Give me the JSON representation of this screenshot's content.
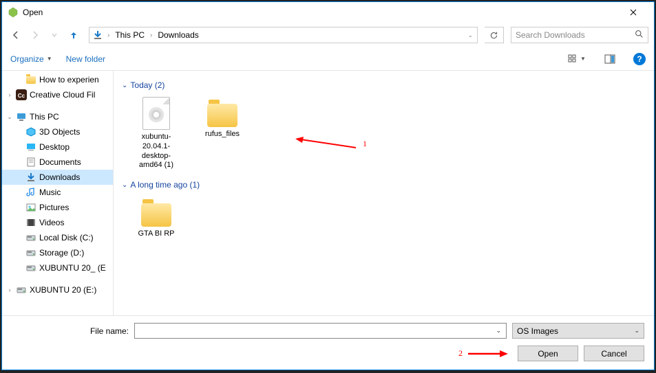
{
  "window": {
    "title": "Open"
  },
  "nav": {
    "breadcrumbs": [
      "This PC",
      "Downloads"
    ],
    "search_placeholder": "Search Downloads"
  },
  "toolbar": {
    "organize": "Organize",
    "new_folder": "New folder"
  },
  "tree": {
    "items": [
      {
        "label": "How to experien",
        "level": 1,
        "icon": "folder"
      },
      {
        "label": "Creative Cloud Fil",
        "level": 0,
        "icon": "cc",
        "expander": "›"
      },
      {
        "label": "",
        "level": 0,
        "icon": "spacer"
      },
      {
        "label": "This PC",
        "level": 0,
        "icon": "pc",
        "expander": "⌄"
      },
      {
        "label": "3D Objects",
        "level": 1,
        "icon": "3d"
      },
      {
        "label": "Desktop",
        "level": 1,
        "icon": "desktop"
      },
      {
        "label": "Documents",
        "level": 1,
        "icon": "docs"
      },
      {
        "label": "Downloads",
        "level": 1,
        "icon": "downloads",
        "active": true
      },
      {
        "label": "Music",
        "level": 1,
        "icon": "music"
      },
      {
        "label": "Pictures",
        "level": 1,
        "icon": "pictures"
      },
      {
        "label": "Videos",
        "level": 1,
        "icon": "videos"
      },
      {
        "label": "Local Disk (C:)",
        "level": 1,
        "icon": "disk"
      },
      {
        "label": "Storage (D:)",
        "level": 1,
        "icon": "disk"
      },
      {
        "label": "XUBUNTU 20_ (E",
        "level": 1,
        "icon": "disk"
      },
      {
        "label": "",
        "level": 0,
        "icon": "spacer"
      },
      {
        "label": "XUBUNTU 20  (E:)",
        "level": 0,
        "icon": "disk",
        "expander": "›"
      }
    ]
  },
  "content": {
    "groups": [
      {
        "header": "Today (2)",
        "items": [
          {
            "name": "xubuntu-20.04.1-desktop-amd64 (1)",
            "type": "iso"
          },
          {
            "name": "rufus_files",
            "type": "folder"
          }
        ]
      },
      {
        "header": "A long time ago (1)",
        "items": [
          {
            "name": "GTA BI RP",
            "type": "folder"
          }
        ]
      }
    ]
  },
  "footer": {
    "file_name_label": "File name:",
    "file_name_value": "",
    "filter": "OS Images",
    "open": "Open",
    "cancel": "Cancel"
  },
  "annotations": {
    "a1": "1",
    "a2": "2"
  }
}
